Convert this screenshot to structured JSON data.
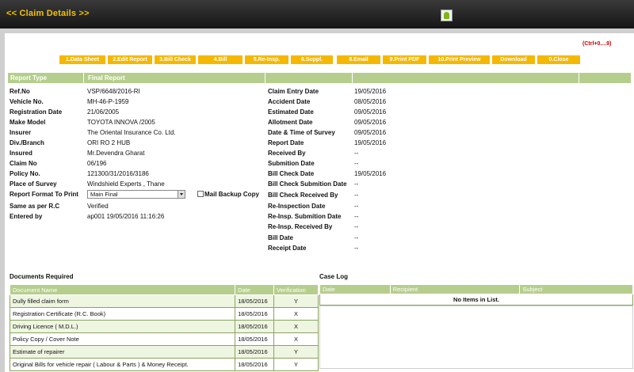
{
  "header": {
    "title": "<< Claim Details >>"
  },
  "shortcut_hint": "(Ctrl+0....9)",
  "toolbar": [
    "1.Data Sheet",
    "2.Edit Report",
    "3.Bill Check",
    "4.Bill",
    "5.Re-Insp.",
    "6.Suppl.",
    "8.Email",
    "9.Print PDF",
    "10.Print Preview",
    "Download",
    "0.Close"
  ],
  "report_header": {
    "type_label": "Report Type",
    "type_value": "Final Report"
  },
  "left_fields": [
    {
      "label": "Ref.No",
      "value": "VSP/6648/2016-RI"
    },
    {
      "label": "Vehicle No.",
      "value": "MH-46-P-1959"
    },
    {
      "label": "Registration Date",
      "value": "21/06/2005"
    },
    {
      "label": "Make Model",
      "value": "TOYOTA INNOVA /2005"
    },
    {
      "label": "Insurer",
      "value": "The Oriental Insurance Co. Ltd."
    },
    {
      "label": "Div./Branch",
      "value": "ORI RO 2 HUB"
    },
    {
      "label": "Insured",
      "value": "Mr.Devendra Gharat"
    },
    {
      "label": "Claim No",
      "value": "06/196"
    },
    {
      "label": "Policy No.",
      "value": "121300/31/2016/3186"
    },
    {
      "label": "Place of Survey",
      "value": "Windshield Experts , Thane"
    },
    {
      "label": "Report Format To Print",
      "value": "Main Final"
    },
    {
      "label": "Same as per R.C",
      "value": "Verified"
    },
    {
      "label": "Entered by",
      "value": "ap001 19/05/2016 11:16:26"
    }
  ],
  "mail_backup_label": "Mail Backup Copy",
  "right_fields": [
    {
      "label": "Claim Entry Date",
      "value": "19/05/2016"
    },
    {
      "label": "Accident Date",
      "value": "08/05/2016"
    },
    {
      "label": "Estimated Date",
      "value": "09/05/2016"
    },
    {
      "label": "Allotment Date",
      "value": "09/05/2016"
    },
    {
      "label": "Date & Time of Survey",
      "value": "09/05/2016"
    },
    {
      "label": "Report Date",
      "value": "19/05/2016"
    },
    {
      "label": "Received By",
      "value": "--"
    },
    {
      "label": "Submition Date",
      "value": "--"
    },
    {
      "label": "Bill Check Date",
      "value": "19/05/2016"
    },
    {
      "label": "Bill Check Submition Date",
      "value": "--"
    },
    {
      "label": "Bill Check Received By",
      "value": "--"
    },
    {
      "label": "Re-Inspection Date",
      "value": "--"
    },
    {
      "label": "Re-Insp. Submition Date",
      "value": "--"
    },
    {
      "label": "Re-Insp. Received By",
      "value": "--"
    },
    {
      "label": "Bill Date",
      "value": "--"
    },
    {
      "label": "Receipt Date",
      "value": "--"
    }
  ],
  "documents": {
    "title": "Documents Required",
    "columns": [
      "Document Name",
      "Date",
      "Verification"
    ],
    "rows": [
      [
        "Dully filled claim form",
        "18/05/2016",
        "Y"
      ],
      [
        "Registration Certificate (R.C. Book)",
        "18/05/2016",
        "X"
      ],
      [
        "Driving Licence ( M.D.L.)",
        "18/05/2016",
        "X"
      ],
      [
        "Policy Copy / Cover Note",
        "18/05/2016",
        "X"
      ],
      [
        "Estimate of repairer",
        "18/05/2016",
        "Y"
      ],
      [
        "Original Bills for vehicle repair ( Labour & Parts ) & Money Receipt.",
        "18/05/2016",
        "Y"
      ]
    ]
  },
  "case_log": {
    "title": "Case Log",
    "columns": [
      "Date",
      "Recipient",
      "Subject"
    ],
    "empty_text": "No Items in List."
  }
}
